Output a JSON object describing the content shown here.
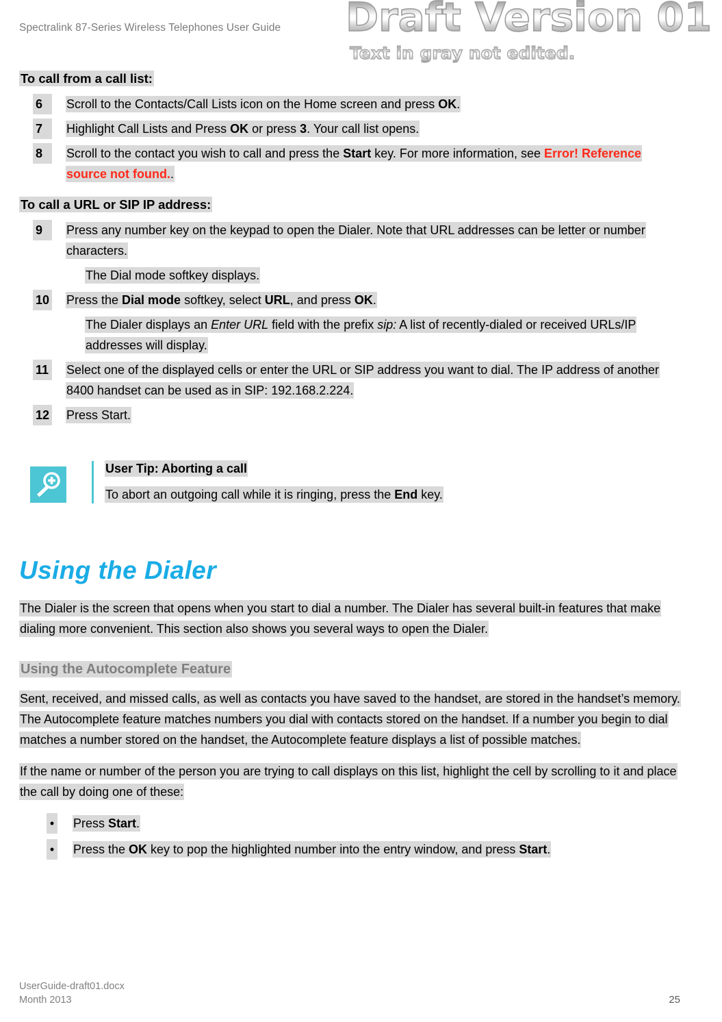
{
  "header": {
    "title": "Spectralink 87-Series Wireless Telephones User Guide"
  },
  "watermark": {
    "main": "Draft Version 01",
    "sub": "Text in gray not edited."
  },
  "colors": {
    "highlight": "#d9d9d9",
    "accent_teal": "#4cc5d4",
    "heading_blue": "#1aace6",
    "error_red": "#ff2a1a",
    "subheading_gray": "#7f7f7f",
    "header_gray": "#7b7b7b"
  },
  "sections": {
    "call_list": {
      "heading": "To call from a call list:",
      "steps": [
        {
          "num": "6",
          "parts": [
            {
              "text": "Scroll to the Contacts/Call Lists icon on the Home screen and press ",
              "bold": false
            },
            {
              "text": "OK",
              "bold": true
            },
            {
              "text": ".",
              "bold": false
            }
          ]
        },
        {
          "num": "7",
          "parts": [
            {
              "text": "Highlight Call Lists and Press ",
              "bold": false
            },
            {
              "text": "OK",
              "bold": true
            },
            {
              "text": " or press ",
              "bold": false
            },
            {
              "text": "3",
              "bold": true
            },
            {
              "text": ". Your call list opens.",
              "bold": false
            }
          ]
        },
        {
          "num": "8",
          "parts": [
            {
              "text": "Scroll to the contact you wish to call and press the ",
              "bold": false
            },
            {
              "text": "Start",
              "bold": true
            },
            {
              "text": " key. For more information, see ",
              "bold": false
            },
            {
              "text": "Error! Reference source not found.",
              "bold": true,
              "error": true
            },
            {
              "text": ".",
              "bold": false
            }
          ]
        }
      ]
    },
    "url_sip": {
      "heading": "To call a URL or SIP IP address:",
      "steps": [
        {
          "num": "9",
          "parts": [
            {
              "text": "Press any number key on the keypad to open the Dialer. Note that URL addresses can be letter or number characters.",
              "bold": false
            }
          ],
          "follow": [
            {
              "parts": [
                {
                  "text": "The Dial mode softkey displays.",
                  "bold": false
                }
              ]
            }
          ]
        },
        {
          "num": "10",
          "parts": [
            {
              "text": "Press the ",
              "bold": false
            },
            {
              "text": "Dial mode",
              "bold": true
            },
            {
              "text": " softkey, select ",
              "bold": false
            },
            {
              "text": "URL",
              "bold": true
            },
            {
              "text": ", and press ",
              "bold": false
            },
            {
              "text": "OK",
              "bold": true
            },
            {
              "text": ".",
              "bold": false
            }
          ],
          "follow": [
            {
              "parts": [
                {
                  "text": "The Dialer displays an ",
                  "bold": false
                },
                {
                  "text": "Enter URL",
                  "italic": true
                },
                {
                  "text": " field with the prefix ",
                  "bold": false
                },
                {
                  "text": "sip:",
                  "italic": true
                },
                {
                  "text": " A list of recently-dialed or received URLs/IP addresses will display.",
                  "bold": false
                }
              ]
            }
          ]
        },
        {
          "num": "11",
          "parts": [
            {
              "text": "Select one of the displayed cells or enter the URL or SIP address you want to dial. The IP address of another 8400 handset can be used as in SIP: 192.168.2.224.",
              "bold": false
            }
          ]
        },
        {
          "num": "12",
          "parts": [
            {
              "text": "Press Start.",
              "bold": false
            }
          ]
        }
      ]
    },
    "tip": {
      "icon": "magnifier-plus-icon",
      "title": "User Tip: Aborting a call",
      "body_parts": [
        {
          "text": "To abort an outgoing call while it is ringing, press the ",
          "bold": false
        },
        {
          "text": "End",
          "bold": true
        },
        {
          "text": " key.",
          "bold": false
        }
      ]
    },
    "dialer": {
      "heading": "Using the Dialer",
      "intro": "The Dialer is the screen that opens when you start to dial a number. The Dialer has several built-in features that make dialing more convenient. This section also shows you several ways to open the Dialer.",
      "subheading": "Using the Autocomplete Feature",
      "paragraph_1": "Sent, received, and missed calls, as well as contacts you have saved to the handset, are stored in the handset’s memory. The Autocomplete feature matches numbers you dial with contacts stored on the handset. If a number you begin to dial matches a number stored on the handset, the Autocomplete feature displays a list of possible matches.",
      "paragraph_2": "If the name or number of the person you are trying to call displays on this list, highlight the cell by scrolling to it and place the call by doing one of these:",
      "bullet_marker": "•",
      "bullets": [
        {
          "parts": [
            {
              "text": "Press ",
              "bold": false
            },
            {
              "text": "Start",
              "bold": true
            },
            {
              "text": ".",
              "bold": false
            }
          ]
        },
        {
          "parts": [
            {
              "text": "Press the ",
              "bold": false
            },
            {
              "text": "OK",
              "bold": true
            },
            {
              "text": " key to pop the highlighted number into the entry window, and press ",
              "bold": false
            },
            {
              "text": "Start",
              "bold": true
            },
            {
              "text": ".",
              "bold": false
            }
          ]
        }
      ]
    }
  },
  "footer": {
    "file": "UserGuide-draft01.docx",
    "date": "Month 2013",
    "page": "25"
  }
}
